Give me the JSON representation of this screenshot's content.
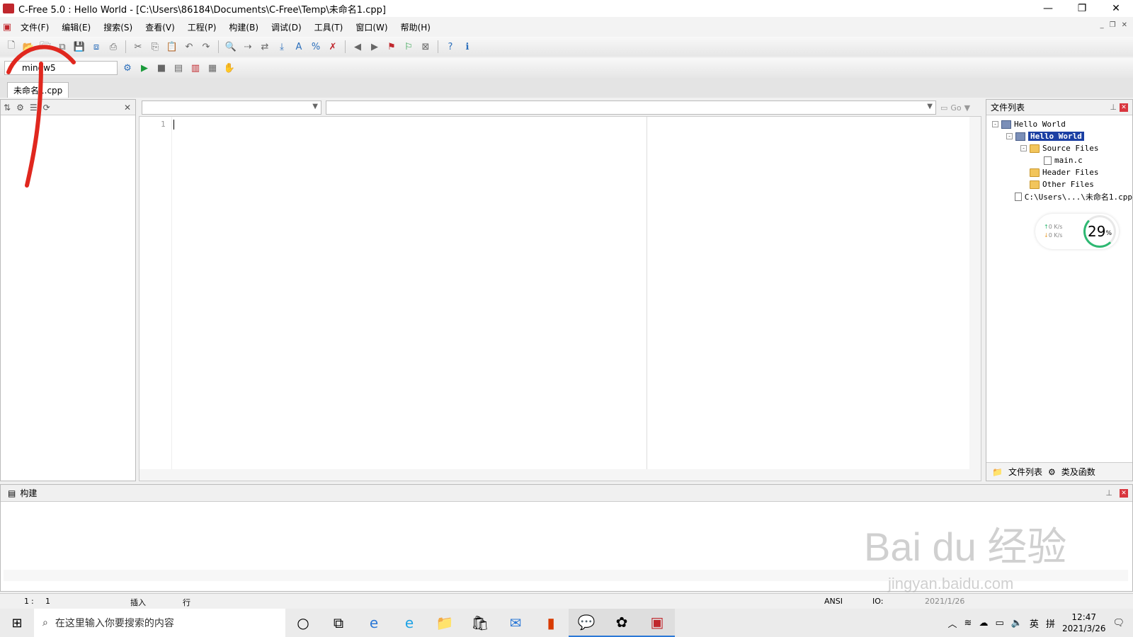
{
  "window": {
    "title": "C-Free 5.0 : Hello World - [C:\\Users\\86184\\Documents\\C-Free\\Temp\\未命名1.cpp]"
  },
  "menu": [
    "文件(F)",
    "编辑(E)",
    "搜索(S)",
    "查看(V)",
    "工程(P)",
    "构建(B)",
    "调试(D)",
    "工具(T)",
    "窗口(W)",
    "帮助(H)"
  ],
  "compiler": {
    "selected": "mingw5"
  },
  "tabs": [
    {
      "label": "未命名1.cpp"
    }
  ],
  "editor": {
    "line_numbers": [
      "1"
    ],
    "go_label": "Go"
  },
  "file_panel": {
    "title": "文件列表",
    "tree": [
      {
        "label": "Hello World",
        "level": 0,
        "icon": "workspace-icon",
        "expander": "-"
      },
      {
        "label": "Hello World",
        "level": 1,
        "icon": "project-icon",
        "expander": "-",
        "selected": true
      },
      {
        "label": "Source Files",
        "level": 2,
        "icon": "folder-icon",
        "expander": "-"
      },
      {
        "label": "main.c",
        "level": 3,
        "icon": "c-file-icon",
        "expander": ""
      },
      {
        "label": "Header Files",
        "level": 2,
        "icon": "folder-icon",
        "expander": ""
      },
      {
        "label": "Other Files",
        "level": 2,
        "icon": "folder-icon",
        "expander": ""
      },
      {
        "label": "C:\\Users\\...\\未命名1.cpp",
        "level": 1,
        "icon": "cpp-file-icon",
        "expander": ""
      }
    ],
    "tab_files": "文件列表",
    "tab_classes": "类及函数"
  },
  "net_widget": {
    "up": "0 K/s",
    "down": "0 K/s",
    "percent": "29",
    "unit": "%"
  },
  "build_panel": {
    "title": "构建"
  },
  "status": {
    "line": "1",
    "col": "1",
    "mode": "插入",
    "row_label": "行",
    "encoding": "ANSI",
    "extra": "IO:",
    "date_partial": "2021/1/26"
  },
  "taskbar": {
    "search_placeholder": "在这里输入你要搜索的内容",
    "time": "12:47",
    "date": "2021/3/26",
    "ime": "英",
    "ime2": "拼"
  },
  "watermark": {
    "brand": "Bai du 经验",
    "url": "jingyan.baidu.com"
  },
  "colors": {
    "selection": "#1b3fa3",
    "annotation": "#e0271e",
    "accent": "#2b78d6"
  }
}
